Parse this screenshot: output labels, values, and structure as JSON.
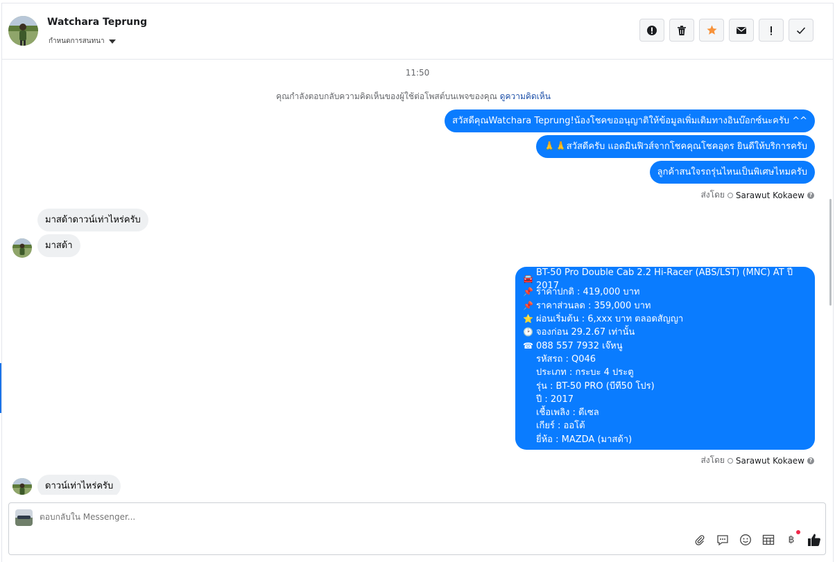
{
  "header": {
    "contact_name": "Watchara Teprung",
    "assign_label": "กำหนดการสนทนา",
    "actions": [
      {
        "name": "report-button",
        "icon": "alert-circle-icon"
      },
      {
        "name": "delete-button",
        "icon": "trash-icon"
      },
      {
        "name": "star-button",
        "icon": "star-icon"
      },
      {
        "name": "mark-unread-button",
        "icon": "envelope-icon"
      },
      {
        "name": "mark-spam-button",
        "icon": "exclamation-icon"
      },
      {
        "name": "done-button",
        "icon": "check-icon"
      }
    ],
    "star_color": "#f7923a"
  },
  "conversation": {
    "timestamp": "11:50",
    "notice_text": "คุณกำลังตอบกลับความคิดเห็นของผู้ใช้ต่อโพสต์บนเพจของคุณ",
    "notice_link": "ดูความคิดเห็น",
    "messages": [
      {
        "from": "page",
        "text": "สวัสดีคุณWatchara Teprung!น้องโชคขออนุญาติให้ข้อมูลเพิ่มเติมทางอินบ๊อกซ์นะครับ ^^"
      },
      {
        "from": "page",
        "emoji": "🙏🙏",
        "text": "สวัสดีครับ แอดมินฟิวส์จากโชคคุณโชคอุดร ยินดีให้บริการครับ"
      },
      {
        "from": "page",
        "text": "ลูกค้าสนใจรถรุ่นไหนเป็นพิเศษไหมครับ"
      },
      {
        "from": "user",
        "text": "มาสด้าดาวน์เท่าไหร่ครับ"
      },
      {
        "from": "user",
        "text": "มาสด้า"
      },
      {
        "from": "user",
        "text": "ดาวน์เท่าไหร่ครับ"
      }
    ],
    "sent_by_label": "ส่งโดย",
    "sent_by_name": "Sarawut Kokaew",
    "car_card": {
      "lines": [
        {
          "icon": "🚘",
          "text": "BT-50 Pro Double Cab 2.2 Hi-Racer (ABS/LST) (MNC) AT ปี 2017"
        },
        {
          "icon": "📌",
          "text": "ราคาปกติ : 419,000 บาท"
        },
        {
          "icon": "📌",
          "text": "ราคาส่วนลด : 359,000 บาท"
        },
        {
          "icon": "⭐",
          "text": "ผ่อนเริ่มต้น : 6,xxx บาท ตลอดสัญญา"
        },
        {
          "icon": "🕑",
          "text": "จองก่อน 29.2.67 เท่านั้น"
        },
        {
          "icon": "☎",
          "text": " 088 557 7932 เจ๊หนู"
        },
        {
          "icon": "",
          "text": "รหัสรถ : Q046"
        },
        {
          "icon": "",
          "text": "ประเภท : กระบะ 4 ประตู"
        },
        {
          "icon": "",
          "text": "รุ่น : BT-50 PRO (บีที50 โปร)"
        },
        {
          "icon": "",
          "text": "ปี : 2017"
        },
        {
          "icon": "",
          "text": "เชื้อเพลิง : ดีเซล"
        },
        {
          "icon": "",
          "text": "เกียร์ : ออโต้"
        },
        {
          "icon": "",
          "text": "ยี่ห้อ : MAZDA (มาสด้า)"
        }
      ]
    }
  },
  "composer": {
    "placeholder": "ตอบกลับใน Messenger...",
    "tools": [
      "paperclip-icon",
      "saved-reply-icon",
      "emoji-icon",
      "template-icon",
      "baht-payment-icon",
      "thumbs-up-icon"
    ],
    "baht_symbol": "฿"
  },
  "colors": {
    "outgoing_bubble": "#0a7cff",
    "incoming_bubble": "#eef0f2",
    "link": "#1c4fa8"
  }
}
